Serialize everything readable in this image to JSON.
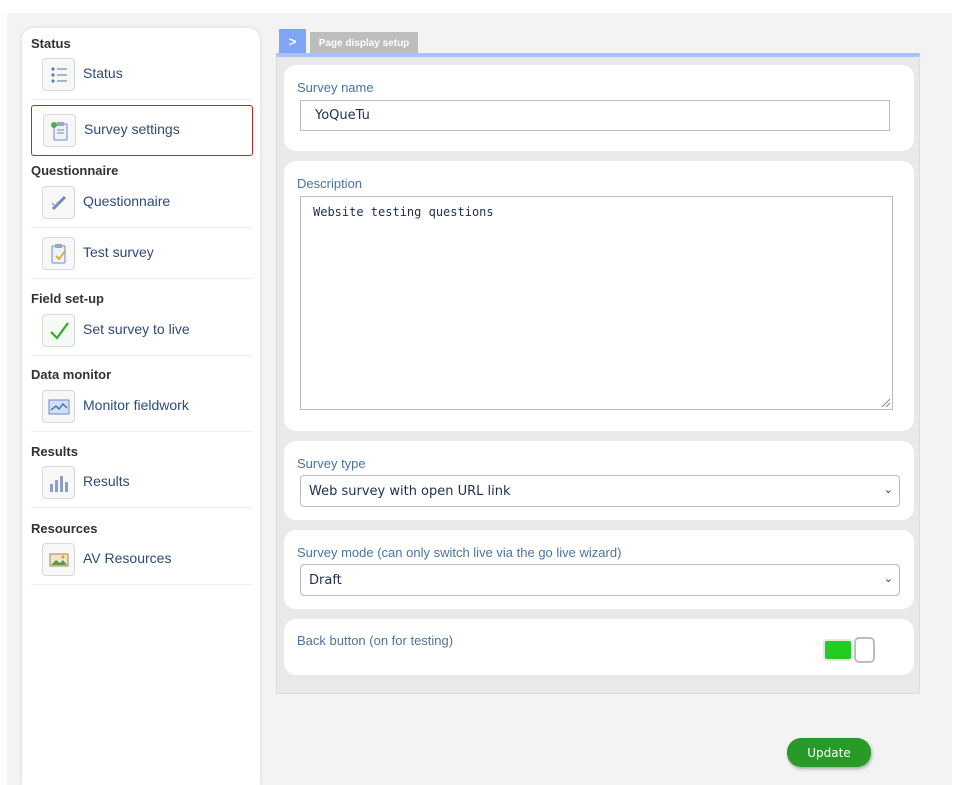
{
  "sidebar": {
    "sections": [
      {
        "title": "Status",
        "items": [
          {
            "label": "Status",
            "icon": "list-icon"
          },
          {
            "label": "Survey settings",
            "icon": "settings-clipboard-icon",
            "active": true
          }
        ]
      },
      {
        "title": "Questionnaire",
        "items": [
          {
            "label": "Questionnaire",
            "icon": "pencil-icon"
          },
          {
            "label": "Test survey",
            "icon": "test-clipboard-icon"
          }
        ]
      },
      {
        "title": "Field set-up",
        "items": [
          {
            "label": "Set survey to live",
            "icon": "checkmark-icon"
          }
        ]
      },
      {
        "title": "Data monitor",
        "items": [
          {
            "label": "Monitor fieldwork",
            "icon": "monitor-chart-icon"
          }
        ]
      },
      {
        "title": "Results",
        "items": [
          {
            "label": "Results",
            "icon": "bar-chart-icon"
          }
        ]
      },
      {
        "title": "Resources",
        "items": [
          {
            "label": "AV Resources",
            "icon": "image-icon"
          }
        ]
      }
    ],
    "active_border_color": "#cc2222",
    "label_color": "#2e4a7a"
  },
  "tabs": {
    "toggle_label": ">",
    "page_tab_label": "Page display setup",
    "accent_color": "#7ea6f4"
  },
  "form": {
    "survey_name": {
      "label": "Survey name",
      "value": "YoQueTu"
    },
    "description": {
      "label": "Description",
      "value": "Website testing questions"
    },
    "survey_type": {
      "label": "Survey type",
      "selected": "Web survey with open URL link"
    },
    "survey_mode": {
      "label": "Survey mode (can only switch live via the go live wizard)",
      "selected": "Draft"
    },
    "back_button": {
      "label": "Back button (on for testing)",
      "on": true,
      "on_color": "#22cc22"
    }
  },
  "actions": {
    "update_label": "Update",
    "update_color": "#279a27"
  }
}
